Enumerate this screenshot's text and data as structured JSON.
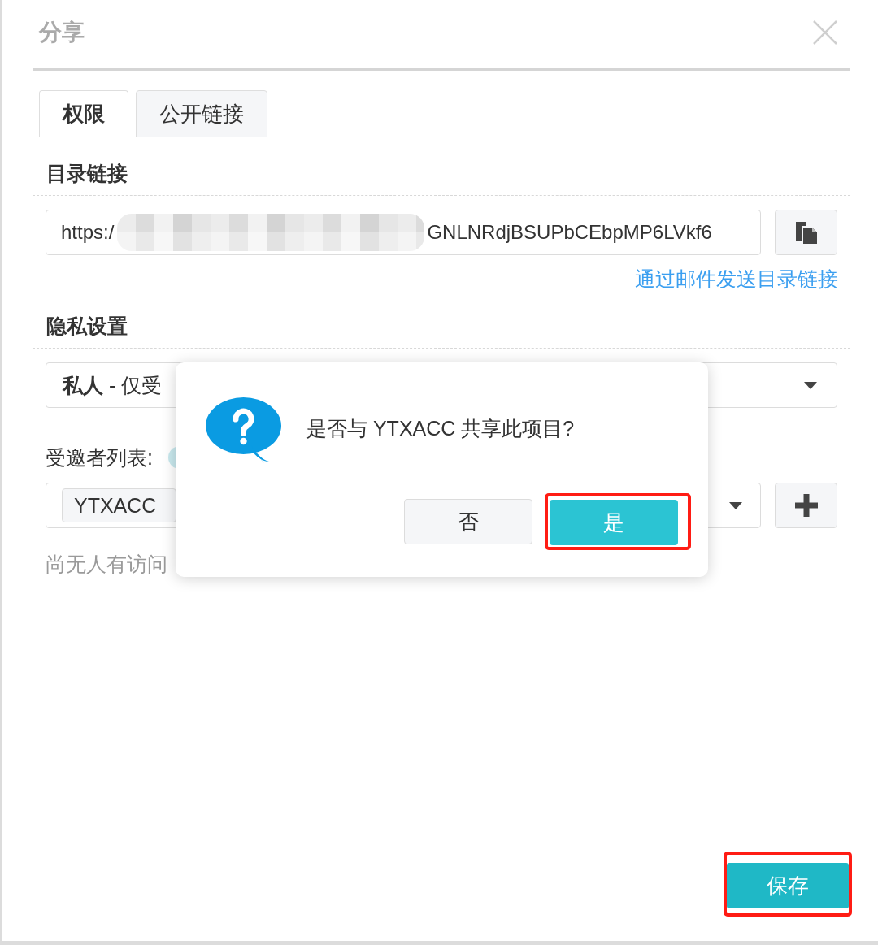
{
  "window": {
    "title": "分享"
  },
  "tabs": [
    {
      "label": "权限",
      "selected": true
    },
    {
      "label": "公开链接",
      "selected": false
    }
  ],
  "directory_link": {
    "heading": "目录链接",
    "url_start": "https:/",
    "url_end": "GNLNRdjBSUPbCEbpMP6LVkf6",
    "email_link": "通过邮件发送目录链接"
  },
  "privacy": {
    "heading": "隐私设置",
    "value": "**私人** - 仅受"
  },
  "invitees": {
    "label": "受邀者列表:",
    "tags": [
      "YTXACC"
    ],
    "empty_note": "尚无人有访问"
  },
  "save_button": {
    "label": "保存",
    "highlighted": true
  },
  "confirm": {
    "message": "是否与 YTXACC 共享此项目?",
    "buttons": [
      {
        "label": "否",
        "kind": "default",
        "highlighted": false
      },
      {
        "label": "是",
        "kind": "primary",
        "highlighted": true
      }
    ]
  }
}
